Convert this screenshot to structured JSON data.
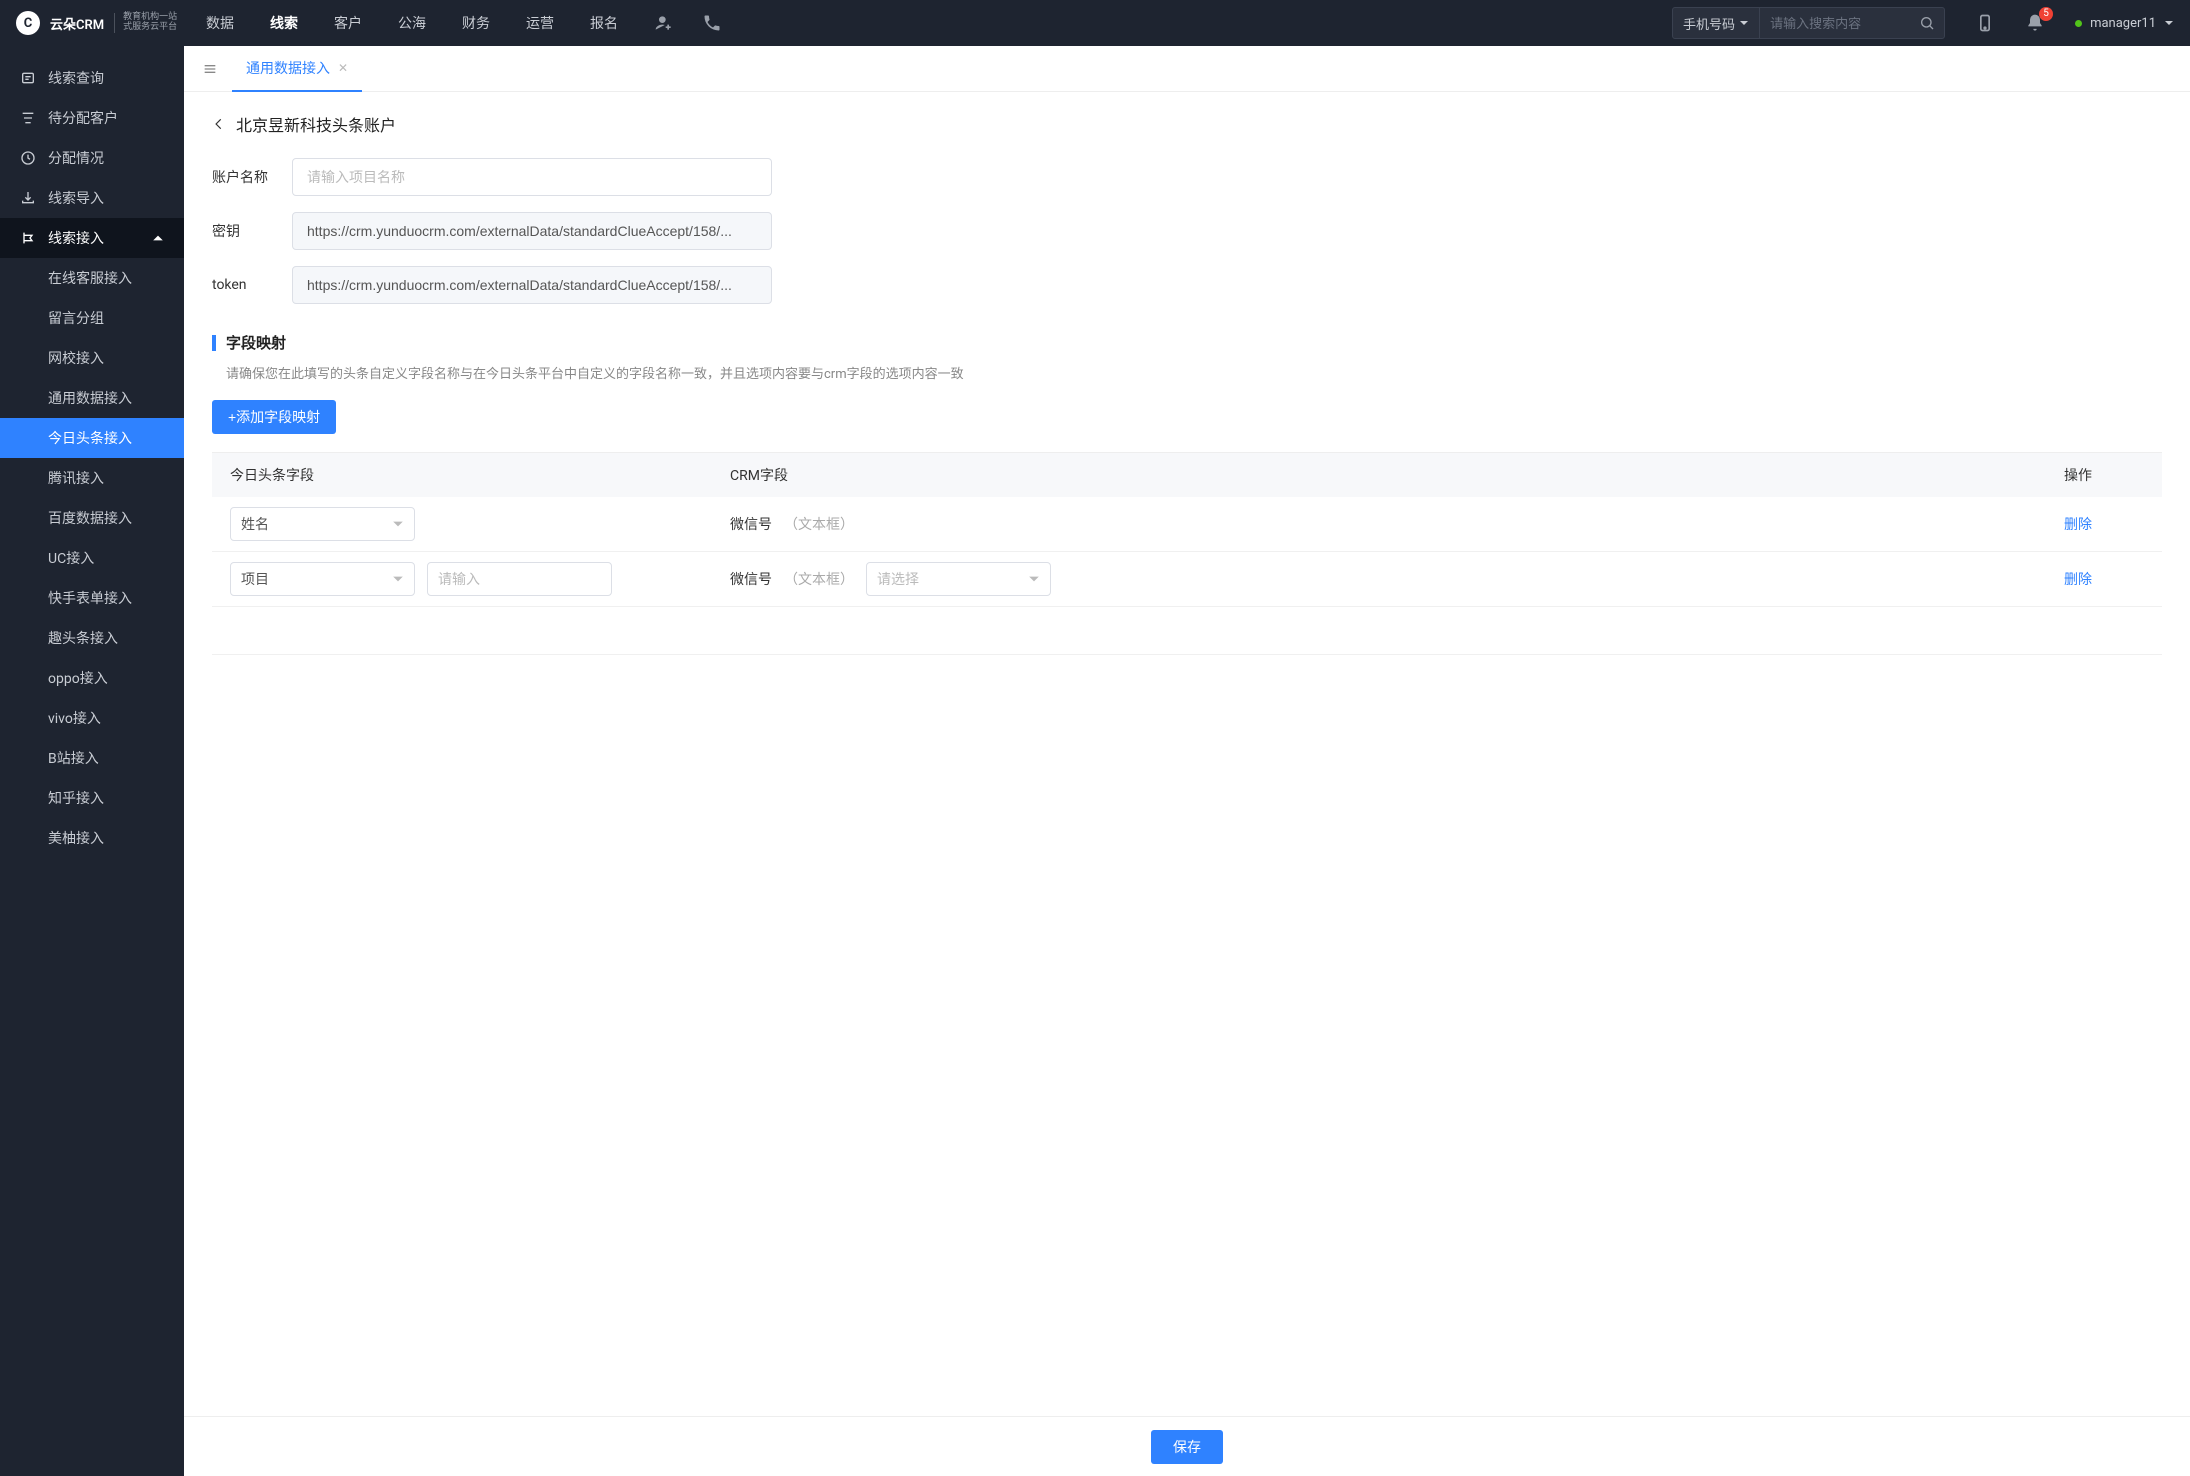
{
  "brand": {
    "name": "云朵CRM",
    "sub1": "教育机构一站",
    "sub2": "式服务云平台"
  },
  "topnav": [
    "数据",
    "线索",
    "客户",
    "公海",
    "财务",
    "运营",
    "报名"
  ],
  "topnav_active": 1,
  "search": {
    "selected": "手机号码",
    "placeholder": "请输入搜索内容"
  },
  "notif_count": "5",
  "user": "manager11",
  "sidebar": {
    "items": [
      {
        "label": "线索查询"
      },
      {
        "label": "待分配客户"
      },
      {
        "label": "分配情况"
      },
      {
        "label": "线索导入"
      },
      {
        "label": "线索接入"
      }
    ],
    "subs": [
      "在线客服接入",
      "留言分组",
      "网校接入",
      "通用数据接入",
      "今日头条接入",
      "腾讯接入",
      "百度数据接入",
      "UC接入",
      "快手表单接入",
      "趣头条接入",
      "oppo接入",
      "vivo接入",
      "B站接入",
      "知乎接入",
      "美柚接入"
    ],
    "sub_active": 4
  },
  "tab": {
    "label": "通用数据接入"
  },
  "page": {
    "title": "北京昱新科技头条账户",
    "fields": {
      "name_label": "账户名称",
      "name_placeholder": "请输入项目名称",
      "key_label": "密钥",
      "key_value": "https://crm.yunduocrm.com/externalData/standardClueAccept/158/...",
      "token_label": "token",
      "token_value": "https://crm.yunduocrm.com/externalData/standardClueAccept/158/..."
    },
    "section": {
      "title": "字段映射",
      "note": "请确保您在此填写的头条自定义字段名称与在今日头条平台中自定义的字段名称一致，并且选项内容要与crm字段的选项内容一致",
      "add_btn": "+添加字段映射"
    },
    "table": {
      "cols": [
        "今日头条字段",
        "CRM字段",
        "操作"
      ],
      "rows": [
        {
          "tt_select": "姓名",
          "crm_label": "微信号",
          "crm_type": "（文本框）",
          "delete": "删除"
        },
        {
          "tt_select": "项目",
          "tt_input_placeholder": "请输入",
          "crm_label": "微信号",
          "crm_type": "（文本框）",
          "crm_select_placeholder": "请选择",
          "delete": "删除"
        }
      ]
    },
    "save": "保存"
  }
}
